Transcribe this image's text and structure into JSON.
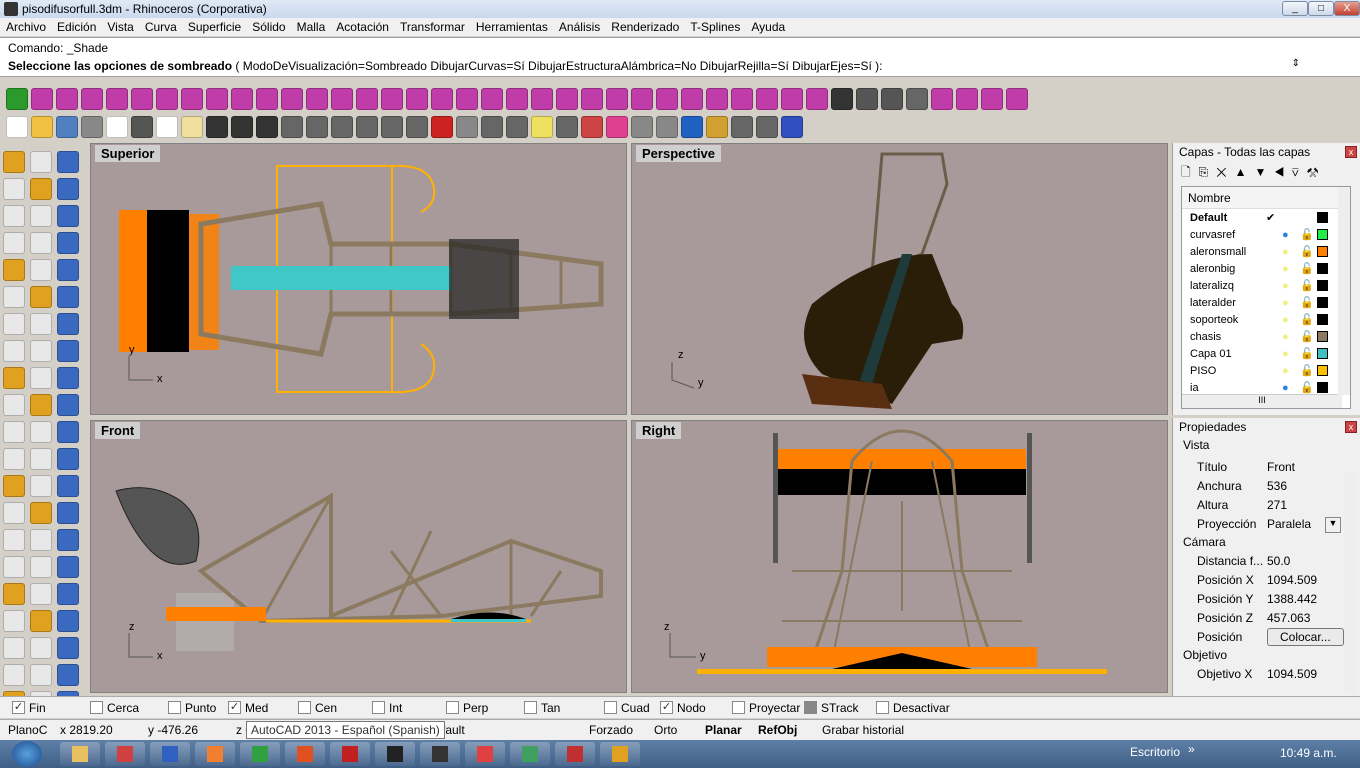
{
  "window": {
    "title": "pisodifusorfull.3dm - Rhinoceros (Corporativa)",
    "min": "_",
    "max": "□",
    "close": "X"
  },
  "menu": [
    "Archivo",
    "Edición",
    "Vista",
    "Curva",
    "Superficie",
    "Sólido",
    "Malla",
    "Acotación",
    "Transformar",
    "Herramientas",
    "Análisis",
    "Renderizado",
    "T-Splines",
    "Ayuda"
  ],
  "command": {
    "history": "Comando: _Shade",
    "prompt_bold": "Seleccione las opciones de sombreado",
    "prompt_rest": " ( ModoDeVisualización=Sombreado  DibujarCurvas=Sí  DibujarEstructuraAlámbrica=No  DibujarRejilla=Sí  DibujarEjes=Sí ):"
  },
  "toolbar1_icons": [
    "#2a9a2a",
    "#c03ca8",
    "#c03ca8",
    "#c03ca8",
    "#c03ca8",
    "#c03ca8",
    "#c03ca8",
    "#c03ca8",
    "#c03ca8",
    "#c03ca8",
    "#c03ca8",
    "#c03ca8",
    "#c03ca8",
    "#c03ca8",
    "#c03ca8",
    "#c03ca8",
    "#c03ca8",
    "#c03ca8",
    "#c03ca8",
    "#c03ca8",
    "#c03ca8",
    "#c03ca8",
    "#c03ca8",
    "#c03ca8",
    "#c03ca8",
    "#c03ca8",
    "#c03ca8",
    "#c03ca8",
    "#c03ca8",
    "#c03ca8",
    "#c03ca8",
    "#c03ca8",
    "#c03ca8",
    "#333333",
    "#555555",
    "#555555",
    "#666666",
    "#c03ca8",
    "#c03ca8",
    "#c03ca8",
    "#c03ca8"
  ],
  "toolbar2_icons": [
    "#ffffff",
    "#f0c040",
    "#5080c0",
    "#888888",
    "#ffffff",
    "#555555",
    "#ffffff",
    "#f0e0a0",
    "#333333",
    "#333333",
    "#333333",
    "#666666",
    "#666666",
    "#666666",
    "#666666",
    "#666666",
    "#666666",
    "#cc2222",
    "#888888",
    "#666666",
    "#666666",
    "#f0e060",
    "#666666",
    "#cc4444",
    "#e04090",
    "#888888",
    "#888888",
    "#2060c0",
    "#d0a030",
    "#666666",
    "#666666",
    "#3050c0"
  ],
  "left_toolbar_icons": 28,
  "viewports": [
    {
      "label": "Superior"
    },
    {
      "label": "Perspective"
    },
    {
      "label": "Front"
    },
    {
      "label": "Right"
    }
  ],
  "axes": {
    "x": "x",
    "y": "y",
    "z": "z"
  },
  "layers": {
    "title": "Capas - Todas las capas",
    "header": "Nombre",
    "rows": [
      {
        "name": "Default",
        "current": true,
        "color": "#000000"
      },
      {
        "name": "curvasref",
        "bulb": "on-blue",
        "color": "#22ee44"
      },
      {
        "name": "aleronsmall",
        "bulb": "on",
        "color": "#ff8000"
      },
      {
        "name": "aleronbig",
        "bulb": "on",
        "color": "#000000"
      },
      {
        "name": "lateralizq",
        "bulb": "on",
        "color": "#000000"
      },
      {
        "name": "lateralder",
        "bulb": "on",
        "color": "#000000"
      },
      {
        "name": "soporteok",
        "bulb": "on",
        "color": "#000000"
      },
      {
        "name": "chasis",
        "bulb": "on",
        "color": "#8b7a60"
      },
      {
        "name": "Capa 01",
        "bulb": "on",
        "color": "#40c0c0"
      },
      {
        "name": "PISO",
        "bulb": "on",
        "color": "#ffc000"
      },
      {
        "name": "ia",
        "bulb": "on-blue",
        "color": "#000000"
      }
    ],
    "check": "✔",
    "scroll_thumb": "III"
  },
  "properties": {
    "title": "Propiedades",
    "section_view": "Vista",
    "rows1": [
      [
        "Título",
        "Front"
      ],
      [
        "Anchura",
        "536"
      ],
      [
        "Altura",
        "271"
      ],
      [
        "Proyección",
        "Paralela"
      ]
    ],
    "section_camera": "Cámara",
    "rows2": [
      [
        "Distancia f...",
        "50.0"
      ],
      [
        "Posición X",
        "1094.509"
      ],
      [
        "Posición Y",
        "1388.442"
      ],
      [
        "Posición Z",
        "457.063"
      ]
    ],
    "position_label": "Posición",
    "place_button": "Colocar...",
    "section_target": "Objetivo",
    "rows3": [
      [
        "Objetivo X",
        "1094.509"
      ]
    ]
  },
  "osnap": [
    {
      "label": "Fin",
      "checked": true
    },
    {
      "label": "Cerca",
      "checked": false
    },
    {
      "label": "Punto",
      "checked": false
    },
    {
      "label": "Med",
      "checked": true
    },
    {
      "label": "Cen",
      "checked": false
    },
    {
      "label": "Int",
      "checked": false
    },
    {
      "label": "Perp",
      "checked": false
    },
    {
      "label": "Tan",
      "checked": false
    },
    {
      "label": "Cuad",
      "checked": false
    },
    {
      "label": "Nodo",
      "checked": true
    },
    {
      "label": "Proyectar",
      "checked": false
    },
    {
      "label": "STrack",
      "checked": false
    },
    {
      "label": "Desactivar",
      "checked": false
    }
  ],
  "status": {
    "cplane": "PlanoC",
    "x": "x 2819.20",
    "y": "y -476.26",
    "z": "z 0",
    "layer": "fault",
    "tooltip": "AutoCAD 2013 - Español (Spanish)",
    "forzado": "Forzado",
    "orto": "Orto",
    "planar": "Planar",
    "refobj": "RefObj",
    "history": "Grabar historial"
  },
  "taskbar": {
    "desktop": "Escritorio",
    "chevron": "»",
    "clock": "10:49 a.m."
  },
  "colors": {
    "viewport_bg": "#a89a9b",
    "chassis": "#8b7a60",
    "orange": "#ff8000",
    "cyan": "#40c8c8",
    "gold": "#ffb000"
  }
}
